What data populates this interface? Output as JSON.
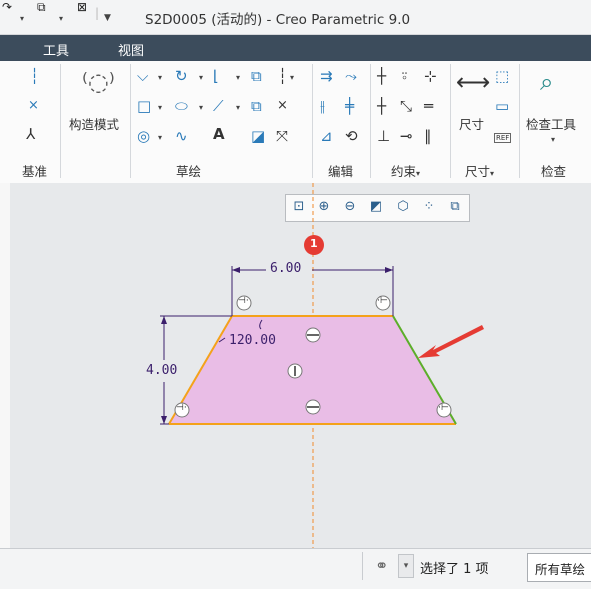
{
  "window": {
    "title": "S2D0005 (活动的) - Creo Parametric 9.0"
  },
  "menu": {
    "items": [
      "工具",
      "视图"
    ]
  },
  "ribbon": {
    "groups": {
      "datum": "基准",
      "sketch": "草绘",
      "edit": "编辑",
      "constrain": "约束",
      "dimension": "尺寸",
      "inspect": "检查"
    },
    "construction_mode_label": "构造模式",
    "dimension_label": "尺寸",
    "inspect_tool_label": "检查工具",
    "text_tool_glyph": "A",
    "ref_badge": "REF",
    "caret": "▾"
  },
  "sketch": {
    "top_width": "6.00",
    "height": "4.00",
    "angle": "120.00",
    "badge_number": "1",
    "fill_color": "#e9bde6",
    "edge_color": "#f4a21a",
    "green_edge_color": "#5cae2a",
    "centerline_color": "#f08a2c",
    "dimension_color": "#3b1f6b",
    "arrow_color": "#e53b33"
  },
  "status": {
    "message": "选择了 1 项",
    "filter": "所有草绘"
  }
}
